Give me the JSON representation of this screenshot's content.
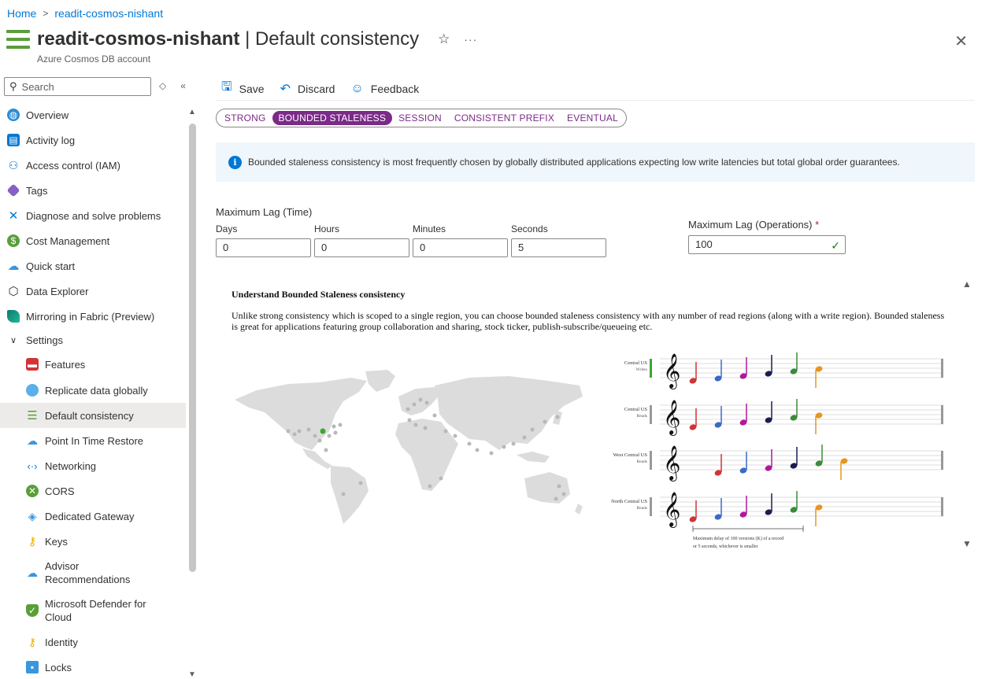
{
  "breadcrumb": {
    "home": "Home",
    "resource": "readit-cosmos-nishant"
  },
  "header": {
    "resource_name": "readit-cosmos-nishant",
    "separator": "|",
    "blade_title": "Default consistency",
    "subtitle": "Azure Cosmos DB account"
  },
  "search": {
    "placeholder": "Search"
  },
  "sidebar": {
    "items": [
      {
        "label": "Overview",
        "icon": "globe-icon"
      },
      {
        "label": "Activity log",
        "icon": "log-icon"
      },
      {
        "label": "Access control (IAM)",
        "icon": "people-icon"
      },
      {
        "label": "Tags",
        "icon": "tag-icon"
      },
      {
        "label": "Diagnose and solve problems",
        "icon": "wrench-icon"
      },
      {
        "label": "Cost Management",
        "icon": "cost-icon"
      },
      {
        "label": "Quick start",
        "icon": "cloud-icon"
      },
      {
        "label": "Data Explorer",
        "icon": "cube-icon"
      },
      {
        "label": "Mirroring in Fabric (Preview)",
        "icon": "fabric-icon"
      }
    ],
    "settings_group": "Settings",
    "settings_items": [
      {
        "label": "Features",
        "icon": "toolbox-icon"
      },
      {
        "label": "Replicate data globally",
        "icon": "globe-pin-icon"
      },
      {
        "label": "Default consistency",
        "icon": "consistency-icon"
      },
      {
        "label": "Point In Time Restore",
        "icon": "restore-icon"
      },
      {
        "label": "Networking",
        "icon": "network-icon"
      },
      {
        "label": "CORS",
        "icon": "cors-icon"
      },
      {
        "label": "Dedicated Gateway",
        "icon": "gateway-icon"
      },
      {
        "label": "Keys",
        "icon": "key-icon"
      },
      {
        "label": "Advisor Recommendations",
        "icon": "advisor-icon"
      },
      {
        "label": "Microsoft Defender for Cloud",
        "icon": "shield-icon"
      },
      {
        "label": "Identity",
        "icon": "identity-icon"
      },
      {
        "label": "Locks",
        "icon": "lock-icon"
      }
    ]
  },
  "toolbar": {
    "save": "Save",
    "discard": "Discard",
    "feedback": "Feedback"
  },
  "consistency": {
    "levels": [
      "STRONG",
      "BOUNDED STALENESS",
      "SESSION",
      "CONSISTENT PREFIX",
      "EVENTUAL"
    ],
    "selected": "BOUNDED STALENESS"
  },
  "info": "Bounded staleness consistency is most frequently chosen by globally distributed applications expecting low write latencies but total global order guarantees.",
  "max_lag_time": {
    "label": "Maximum Lag (Time)",
    "days_label": "Days",
    "days": "0",
    "hours_label": "Hours",
    "hours": "0",
    "minutes_label": "Minutes",
    "minutes": "0",
    "seconds_label": "Seconds",
    "seconds": "5"
  },
  "max_lag_ops": {
    "label": "Maximum Lag (Operations)",
    "required": "*",
    "value": "100"
  },
  "understand": {
    "title": "Understand Bounded Staleness consistency",
    "body": "Unlike strong consistency which is scoped to a single region, you can choose bounded staleness consistency with any number of read regions (along with a write region). Bounded staleness is great for applications featuring group collaboration and sharing, stock ticker, publish-subscribe/queueing etc.",
    "regions": [
      {
        "name": "Central US",
        "role": "Writes"
      },
      {
        "name": "Central US",
        "role": "Reads"
      },
      {
        "name": "West Central US",
        "role": "Reads"
      },
      {
        "name": "North Central US",
        "role": "Reads"
      }
    ],
    "caption_line1": "Maximum delay of 100 versions (K) of a record",
    "caption_line2": "or 5 seconds, whichever is smaller"
  },
  "colors": {
    "accent": "#0078d4",
    "selected_pill": "#7b2a88",
    "resource_green": "#5a9e3a"
  }
}
